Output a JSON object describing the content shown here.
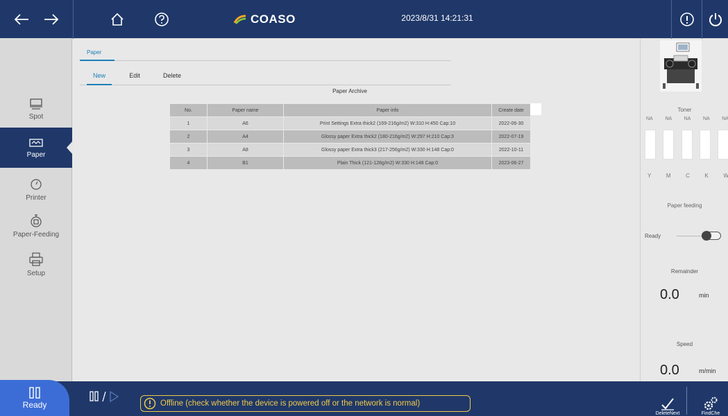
{
  "header": {
    "brand": "COASO",
    "datetime": "2023/8/31 14:21:31",
    "brand_color": "#1f3869"
  },
  "sidebar": {
    "items": [
      {
        "label": "Spot",
        "icon": "spot-icon"
      },
      {
        "label": "Paper",
        "icon": "paper-icon",
        "active": true
      },
      {
        "label": "Printer",
        "icon": "printer-gauge-icon"
      },
      {
        "label": "Paper-Feeding",
        "icon": "paper-feeding-icon"
      },
      {
        "label": "Setup",
        "icon": "setup-printer-icon"
      }
    ]
  },
  "main": {
    "top_tab": "Paper",
    "subtabs": [
      "New",
      "Edit",
      "Delete"
    ],
    "table": {
      "caption": "Paper Archive",
      "headers": [
        "No.",
        "Paper name",
        "Paper info",
        "Create date"
      ],
      "rows": [
        [
          "1",
          "A6",
          "Print Settings Extra thick2 (169-216g/m2) W:310 H:450 Cap:10",
          "2022-06-30"
        ],
        [
          "2",
          "A4",
          "Glossy paper Extra thick2 (180-216g/m2) W:297 H:210 Cap:3",
          "2022-07-19"
        ],
        [
          "3",
          "A8",
          "Glossy paper Extra thick3 (217-256g/m2) W:330 H:148 Cap:0",
          "2022-10-11"
        ],
        [
          "4",
          "B1",
          "Plain Thick (121-128g/m2) W:330 H:148 Cap:0",
          "2023-06-27"
        ]
      ]
    }
  },
  "right_panel": {
    "toner_title": "Toner",
    "toner_levels": [
      "NA",
      "NA",
      "NA",
      "NA",
      "NA"
    ],
    "toner_colors": [
      "Y",
      "M",
      "C",
      "K",
      "W"
    ],
    "feeding_title": "Paper feeding",
    "ready_label": "Ready",
    "remainder_title": "Remainder",
    "remainder_value": "0.0",
    "remainder_unit": "min",
    "speed_title": "Speed",
    "speed_value": "0.0",
    "speed_unit": "m/min"
  },
  "footer": {
    "status_label": "Ready",
    "message": "Offline (check whether the device is powered off or the network is normal)",
    "btn_left_label": "DeleteNext",
    "btn_right_label": "FindChe"
  }
}
